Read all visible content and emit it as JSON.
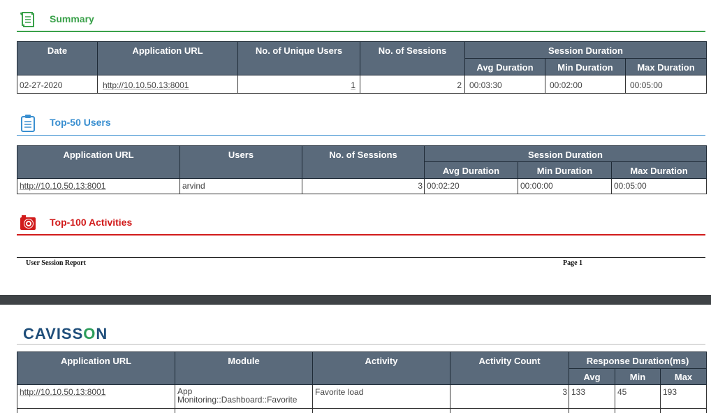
{
  "summary": {
    "title": "Summary",
    "headers": {
      "date": "Date",
      "url": "Application URL",
      "unique_users": "No. of Unique Users",
      "sessions": "No. of Sessions",
      "session_duration": "Session Duration",
      "avg": "Avg Duration",
      "min": "Min Duration",
      "max": "Max Duration"
    },
    "row": {
      "date": "02-27-2020",
      "url": "http://10.10.50.13:8001",
      "unique_users": "1",
      "sessions": "2",
      "avg": "00:03:30",
      "min": "00:02:00",
      "max": "00:05:00"
    }
  },
  "top_users": {
    "title": "Top-50 Users",
    "headers": {
      "url": "Application URL",
      "users": "Users",
      "sessions": "No. of Sessions",
      "session_duration": "Session Duration",
      "avg": "Avg Duration",
      "min": "Min Duration",
      "max": "Max Duration"
    },
    "row": {
      "url": "http://10.10.50.13:8001",
      "users": "arvind",
      "sessions": "3",
      "avg": "00:02:20",
      "min": "00:00:00",
      "max": "00:05:00"
    }
  },
  "top_activities": {
    "title": "Top-100 Activities"
  },
  "footer": {
    "left": "User Session Report",
    "right": "Page 1"
  },
  "page2": {
    "logo_pre": "CAVISS",
    "logo_o": "O",
    "logo_post": "N",
    "headers": {
      "url": "Application URL",
      "module": "Module",
      "activity": "Activity",
      "count": "Activity Count",
      "response": "Response Duration(ms)",
      "avg": "Avg",
      "min": "Min",
      "max": "Max"
    },
    "row": {
      "url": "http://10.10.50.13:8001",
      "module_line1": "App",
      "module_line2": "Monitoring::Dashboard::Favorite",
      "activity": "Favorite load",
      "count": "3",
      "avg": "133",
      "min": "45",
      "max": "193"
    }
  },
  "colors": {
    "summary": "#3aa14a",
    "users": "#3a8fd0",
    "activities": "#d11b1b",
    "header_bg": "#5a6a7b"
  }
}
